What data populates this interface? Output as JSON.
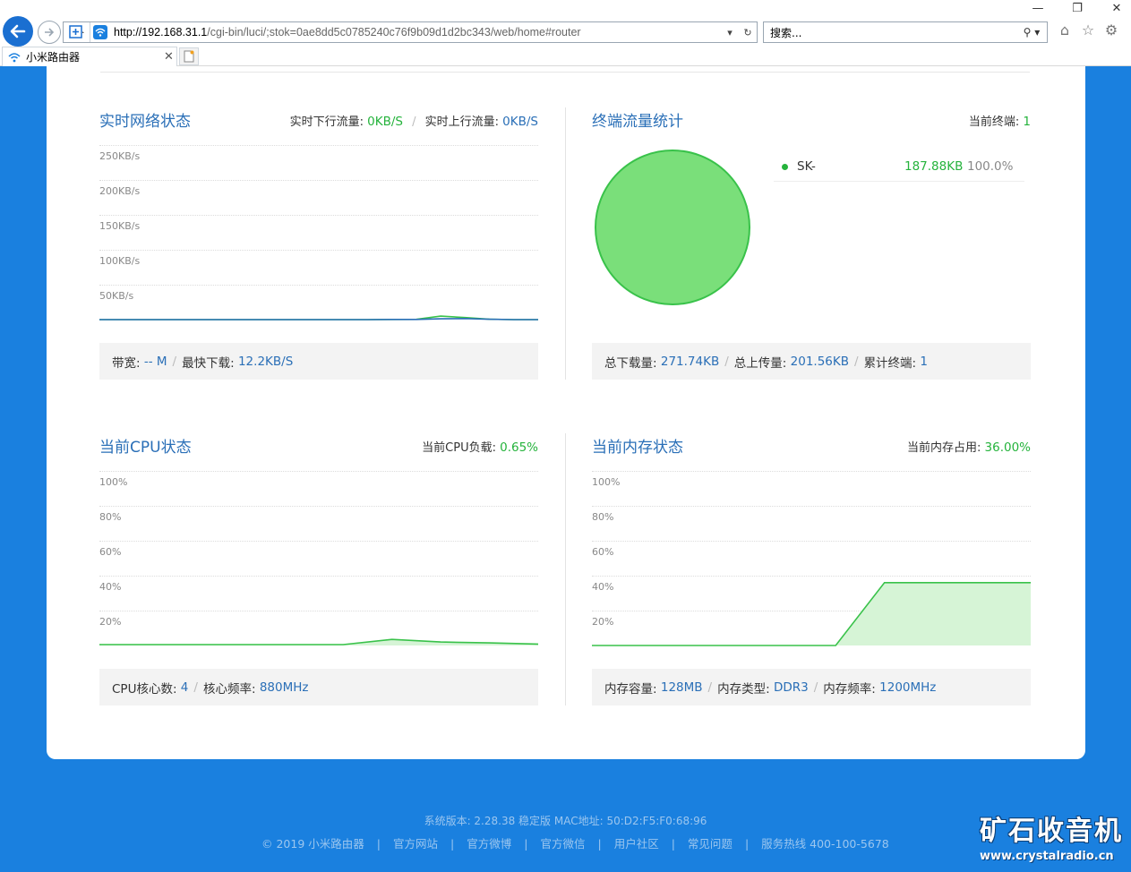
{
  "browser": {
    "url_host": "http://192.168.31.1",
    "url_rest": "/cgi-bin/luci/;stok=0ae8dd5c0785240c76f9b09d1d2bc343/web/home#router",
    "search_placeholder": "搜索...",
    "tab_title": "小米路由器"
  },
  "network": {
    "title": "实时网络状态",
    "down_label": "实时下行流量:",
    "down_value": "0KB/S",
    "up_label": "实时上行流量:",
    "up_value": "0KB/S",
    "y_labels": [
      "250KB/s",
      "200KB/s",
      "150KB/s",
      "100KB/s",
      "50KB/s"
    ],
    "bandwidth_label": "带宽:",
    "bandwidth_value": "-- M",
    "maxdown_label": "最快下载:",
    "maxdown_value": "12.2KB/S"
  },
  "terminal": {
    "title": "终端流量统计",
    "current_label": "当前终端:",
    "current_value": "1",
    "device_name": "SK-",
    "device_traffic": "187.88KB",
    "device_percent": "100.0%",
    "total_down_label": "总下载量:",
    "total_down_value": "271.74KB",
    "total_up_label": "总上传量:",
    "total_up_value": "201.56KB",
    "cumulative_label": "累计终端:",
    "cumulative_value": "1"
  },
  "cpu": {
    "title": "当前CPU状态",
    "load_label": "当前CPU负载:",
    "load_value": "0.65%",
    "y_labels": [
      "100%",
      "80%",
      "60%",
      "40%",
      "20%"
    ],
    "cores_label": "CPU核心数:",
    "cores_value": "4",
    "freq_label": "核心频率:",
    "freq_value": "880MHz"
  },
  "memory": {
    "title": "当前内存状态",
    "usage_label": "当前内存占用:",
    "usage_value": "36.00%",
    "y_labels": [
      "100%",
      "80%",
      "60%",
      "40%",
      "20%"
    ],
    "capacity_label": "内存容量:",
    "capacity_value": "128MB",
    "type_label": "内存类型:",
    "type_value": "DDR3",
    "freq_label": "内存频率:",
    "freq_value": "1200MHz"
  },
  "footer": {
    "version": "系统版本: 2.28.38 稳定版  MAC地址: 50:D2:F5:F0:68:96",
    "links": [
      "© 2019 小米路由器",
      "官方网站",
      "官方微博",
      "官方微信",
      "用户社区",
      "常见问题",
      "服务热线 400-100-5678"
    ]
  },
  "watermark": {
    "title": "矿石收音机",
    "url": "www.crystalradio.cn"
  },
  "colors": {
    "brand_blue": "#1a80df",
    "title_blue": "#2a6fb7",
    "value_green": "#25b33c",
    "chart_line": "#39c24a",
    "chart_fill": "#d6f4d6",
    "pie_fill": "#7adf7a"
  },
  "chart_data": [
    {
      "type": "line",
      "title": "实时网络状态",
      "y_unit": "KB/s",
      "ylim": [
        0,
        250
      ],
      "series": [
        {
          "name": "下行",
          "values": [
            0,
            0,
            0,
            0,
            0,
            0,
            0,
            0,
            0,
            0,
            0,
            0,
            0.2,
            0.4,
            5,
            3,
            0.5,
            0,
            0
          ]
        },
        {
          "name": "上行",
          "values": [
            0,
            0,
            0,
            0,
            0,
            0,
            0,
            0,
            0,
            0,
            0,
            0,
            0.2,
            0.2,
            1.2,
            1.5,
            0.5,
            0,
            0
          ]
        }
      ]
    },
    {
      "type": "pie",
      "title": "终端流量统计",
      "categories": [
        "SK-"
      ],
      "values": [
        187.88
      ]
    },
    {
      "type": "area",
      "title": "当前CPU状态",
      "y_unit": "%",
      "ylim": [
        0,
        100
      ],
      "values": [
        0.5,
        0.5,
        0.5,
        0.5,
        0.5,
        0.5,
        3.5,
        2,
        1.5,
        0.8
      ]
    },
    {
      "type": "area",
      "title": "当前内存状态",
      "y_unit": "%",
      "ylim": [
        0,
        100
      ],
      "values": [
        0,
        0,
        0,
        0,
        0,
        0,
        36,
        36,
        36,
        36
      ]
    }
  ]
}
